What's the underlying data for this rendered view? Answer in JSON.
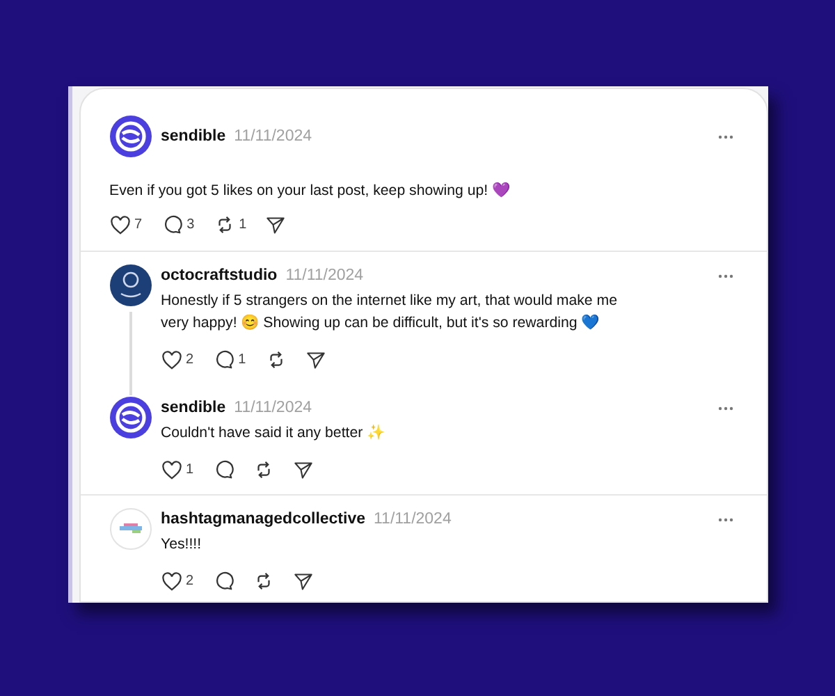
{
  "posts": [
    {
      "kind": "main",
      "author": "sendible",
      "avatar": {
        "kind": "logo"
      },
      "date": "11/11/2024",
      "text": "Even if you got 5 likes on your last post, keep showing up! 💜",
      "likes": "7",
      "comments": "3",
      "reposts": "1",
      "divider": true
    },
    {
      "kind": "reply",
      "author": "octocraftstudio",
      "avatar": {
        "kind": "navy"
      },
      "date": "11/11/2024",
      "text": "Honestly if 5 strangers on the internet like my art, that would make me very happy! 😊 Showing up can be difficult, but it's so rewarding 💙",
      "likes": "2",
      "comments": "1",
      "thread_line": true,
      "divider": false
    },
    {
      "kind": "reply",
      "author": "sendible",
      "avatar": {
        "kind": "logo"
      },
      "date": "11/11/2024",
      "text": "Couldn't have said it any better ✨",
      "likes": "1",
      "thread_line": false,
      "divider": true
    },
    {
      "kind": "reply",
      "author": "hashtagmanagedcollective",
      "avatar": {
        "kind": "light"
      },
      "date": "11/11/2024",
      "text": "Yes!!!!",
      "likes": "2",
      "thread_line": false,
      "divider": true
    }
  ]
}
